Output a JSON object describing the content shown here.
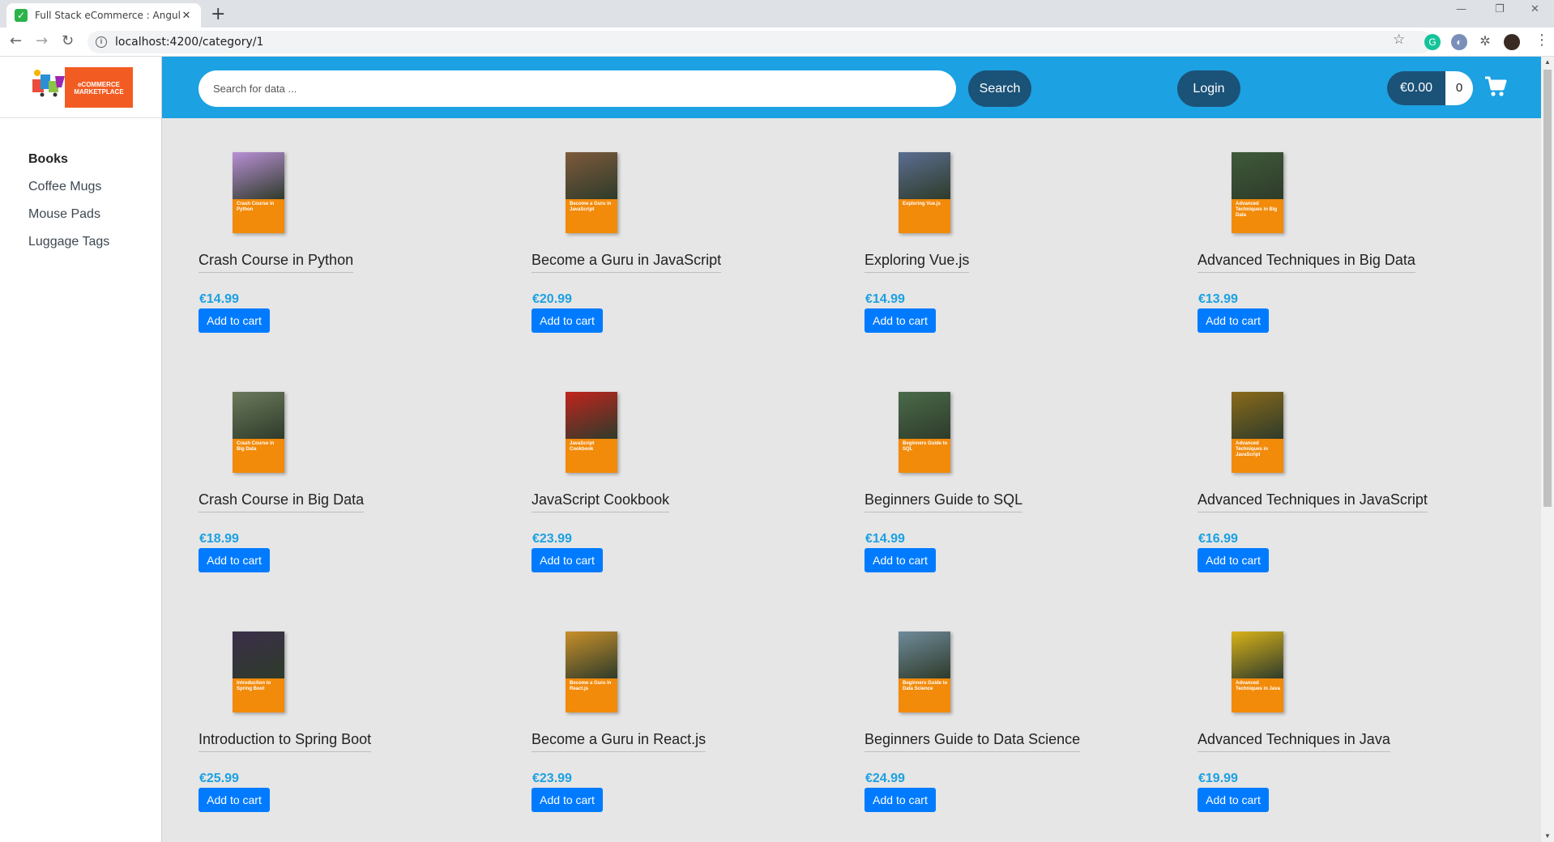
{
  "browser": {
    "tab_title": "Full Stack eCommerce : Angular a",
    "tab_close": "✕",
    "new_tab": "+",
    "url": "localhost:4200/category/1",
    "window_controls": [
      "—",
      "❐",
      "✕"
    ]
  },
  "logo": {
    "text": "eCOMMERCE MARKETPLACE",
    "color": "#f25c22"
  },
  "sidebar": {
    "items": [
      {
        "label": "Books",
        "active": true
      },
      {
        "label": "Coffee Mugs",
        "active": false
      },
      {
        "label": "Mouse Pads",
        "active": false
      },
      {
        "label": "Luggage Tags",
        "active": false
      }
    ]
  },
  "header": {
    "search_placeholder": "Search for data ...",
    "search_label": "Search",
    "login_label": "Login",
    "cart_total": "€0.00",
    "cart_count": "0",
    "color": "#1ca1e2"
  },
  "products": [
    {
      "name": "Crash Course in Python",
      "price": "€14.99",
      "cover_title": "Crash Course in Python",
      "cover_color": "#b98fd6",
      "button": "Add to cart"
    },
    {
      "name": "Become a Guru in JavaScript",
      "price": "€20.99",
      "cover_title": "Become a Guru in JavaScript",
      "cover_color": "#7d5a3c",
      "button": "Add to cart"
    },
    {
      "name": "Exploring Vue.js",
      "price": "€14.99",
      "cover_title": "Exploring Vue.js",
      "cover_color": "#5b6e91",
      "button": "Add to cart"
    },
    {
      "name": "Advanced Techniques in Big Data",
      "price": "€13.99",
      "cover_title": "Advanced Techniques in Big Data",
      "cover_color": "#3f5a3a",
      "button": "Add to cart"
    },
    {
      "name": "Crash Course in Big Data",
      "price": "€18.99",
      "cover_title": "Crash Course in Big Data",
      "cover_color": "#6b7a5c",
      "button": "Add to cart"
    },
    {
      "name": "JavaScript Cookbook",
      "price": "€23.99",
      "cover_title": "JavaScript Cookbook",
      "cover_color": "#c0241e",
      "button": "Add to cart"
    },
    {
      "name": "Beginners Guide to SQL",
      "price": "€14.99",
      "cover_title": "Beginners Guide to SQL",
      "cover_color": "#4a6b4a",
      "button": "Add to cart"
    },
    {
      "name": "Advanced Techniques in JavaScript",
      "price": "€16.99",
      "cover_title": "Advanced Techniques in JavaScript",
      "cover_color": "#8a6a1a",
      "button": "Add to cart"
    },
    {
      "name": "Introduction to Spring Boot",
      "price": "€25.99",
      "cover_title": "Introduction to Spring Boot",
      "cover_color": "#3b2e4a",
      "button": "Add to cart"
    },
    {
      "name": "Become a Guru in React.js",
      "price": "€23.99",
      "cover_title": "Become a Guru in React.js",
      "cover_color": "#c8902a",
      "button": "Add to cart"
    },
    {
      "name": "Beginners Guide to Data Science",
      "price": "€24.99",
      "cover_title": "Beginners Guide to Data Science",
      "cover_color": "#6f8a9a",
      "button": "Add to cart"
    },
    {
      "name": "Advanced Techniques in Java",
      "price": "€19.99",
      "cover_title": "Advanced Techniques in Java",
      "cover_color": "#d9b21a",
      "button": "Add to cart"
    }
  ],
  "colors": {
    "price": "#1ca1e2",
    "button": "#007bff",
    "dark_pill": "#1b5277",
    "cover": "#f28a0a"
  }
}
